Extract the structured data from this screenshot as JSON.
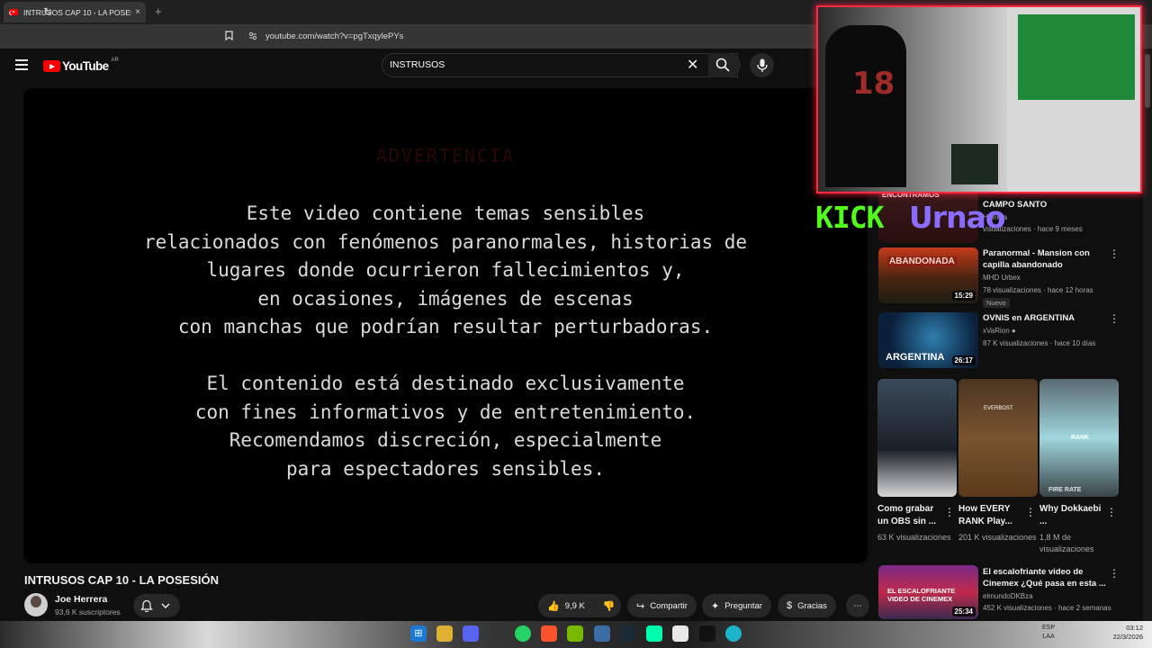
{
  "browser": {
    "tab_title": "INTRUSOS CAP 10 - LA POSESIÓN",
    "tab_close": "×",
    "new_tab": "+",
    "url": "youtube.com/watch?v=pgTxqylePYs"
  },
  "youtube": {
    "logo_text": "YouTube",
    "country_code": "AR",
    "search_query": "INSTRUSOS"
  },
  "video": {
    "warning_title": "ADVERTENCIA",
    "warning_p1": "Este video contiene temas sensibles\nrelacionados con fenómenos paranormales, historias de\nlugares donde ocurrieron fallecimientos y,\nen ocasiones, imágenes de escenas\ncon manchas que podrían resultar perturbadoras.",
    "warning_p2": "El contenido está destinado exclusivamente\ncon fines informativos y de entretenimiento.\nRecomendamos discreción, especialmente\npara espectadores sensibles.",
    "title": "INTRUSOS CAP 10 - LA POSESIÓN",
    "channel": "Joe Herrera",
    "subscribers": "93,6 K suscriptores",
    "likes": "9,9 K",
    "share": "Compartir",
    "ask": "Preguntar",
    "thanks": "Gracias"
  },
  "overlay": {
    "kick": "KICK",
    "streamer": "Urnao",
    "jersey_number": "18"
  },
  "recommendations": [
    {
      "title": "CAMPO SANTO",
      "channel": "Herrera",
      "meta": "visualizaciones · hace 9 meses",
      "thumb_text": "ENCONTRAMOS"
    },
    {
      "title": "Paranormal - Mansion con capilla abandonado",
      "channel": "MHD Urbex",
      "meta": "78 visualizaciones · hace 12 horas",
      "badge": "Nuevo",
      "duration": "15:29",
      "thumb_text": "ABANDONADA"
    },
    {
      "title": "OVNIS en ARGENTINA",
      "channel": "xVaRion",
      "meta": "87 K visualizaciones · hace 10 días",
      "duration": "26:17",
      "thumb_text": "ARGENTINA"
    },
    {
      "title": "El escalofriante video de Cinemex ¿Qué pasa en esta ...",
      "channel": "elmundoDKBza",
      "meta": "452 K visualizaciones · hace 2 semanas",
      "duration": "25:34",
      "thumb_text": "EL ESCALOFRIANTE VIDEO DE CINEMEX"
    }
  ],
  "shorts": [
    {
      "title": "Como grabar un OBS sin ...",
      "views": "63 K visualizaciones"
    },
    {
      "title": "How EVERY RANK Play...",
      "views": "201 K visualizaciones",
      "thumb_text": "EVERBOST"
    },
    {
      "title": "Why Dokkaebi ...",
      "views": "1,8 M de visualizaciones",
      "thumb_text": "RANK",
      "thumb_text2": "FIRE RATE"
    }
  ],
  "taskbar": {
    "lang_line1": "ESP",
    "lang_line2": "LAA",
    "time": "03:12",
    "date": "22/3/2026"
  },
  "icons": [
    "back-icon",
    "forward-icon",
    "reload-icon",
    "bookmark-icon",
    "menu-icon",
    "search-icon",
    "mic-icon",
    "bell-icon",
    "like-icon",
    "dislike-icon",
    "share-icon",
    "sparkle-icon",
    "thanks-icon",
    "more-icon"
  ]
}
